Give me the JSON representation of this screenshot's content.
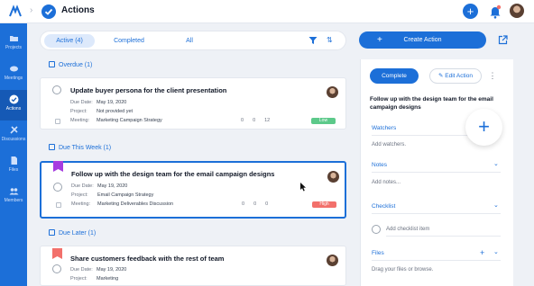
{
  "header": {
    "title": "Actions",
    "add_label": "+"
  },
  "sidebar": {
    "items": [
      {
        "label": "Projects",
        "icon": "folder-icon"
      },
      {
        "label": "Meetings",
        "icon": "meetings-icon"
      },
      {
        "label": "Actions",
        "icon": "check-circle-icon",
        "active": true
      },
      {
        "label": "Discussions",
        "icon": "discussion-icon"
      },
      {
        "label": "Files",
        "icon": "file-icon"
      },
      {
        "label": "Members",
        "icon": "members-icon"
      }
    ]
  },
  "tabs": [
    {
      "label": "Active (4)",
      "active": true
    },
    {
      "label": "Completed"
    },
    {
      "label": "All"
    }
  ],
  "sections": {
    "overdue": "Overdue (1)",
    "this_week": "Due This Week (1)",
    "later": "Due Later (1)"
  },
  "labels": {
    "due_date": "Due Date:",
    "project": "Project:",
    "meeting": "Meeting:"
  },
  "cards": [
    {
      "title": "Update buyer persona for the client presentation",
      "due_date": "May 19, 2020",
      "project": "Not provided yet",
      "meeting": "Marketing Campaign Strategy",
      "c1": "0",
      "c2": "0",
      "c3": "12",
      "priority": "Low",
      "priority_color": "#5cc98a"
    },
    {
      "title": "Follow up with the design team for the email campaign designs",
      "due_date": "May 19, 2020",
      "project": "Email Campaign Strategy",
      "meeting": "Marketing Deliverables Discussion",
      "c1": "0",
      "c2": "0",
      "c3": "0",
      "priority": "High",
      "priority_color": "#f2706b",
      "flag_color": "#a63de0"
    },
    {
      "title": "Share customers feedback with the rest of team",
      "due_date": "May 19, 2020",
      "project": "Marketing",
      "flag_color": "#f2706b"
    }
  ],
  "right": {
    "create_label": "Create Action",
    "complete_label": "Complete",
    "edit_label": "Edit Action",
    "detail_title": "Follow up with the design team for the email campaign designs",
    "watchers": "Watchers",
    "add_watchers": "Add watchers.",
    "notes": "Notes",
    "add_notes": "Add notes...",
    "checklist": "Checklist",
    "add_checklist": "Add checklist item",
    "files": "Files",
    "drag_files": "Drag your files or browse."
  },
  "colors": {
    "accent": "#1c6fd8",
    "sidebar": "#1c6fd8"
  }
}
